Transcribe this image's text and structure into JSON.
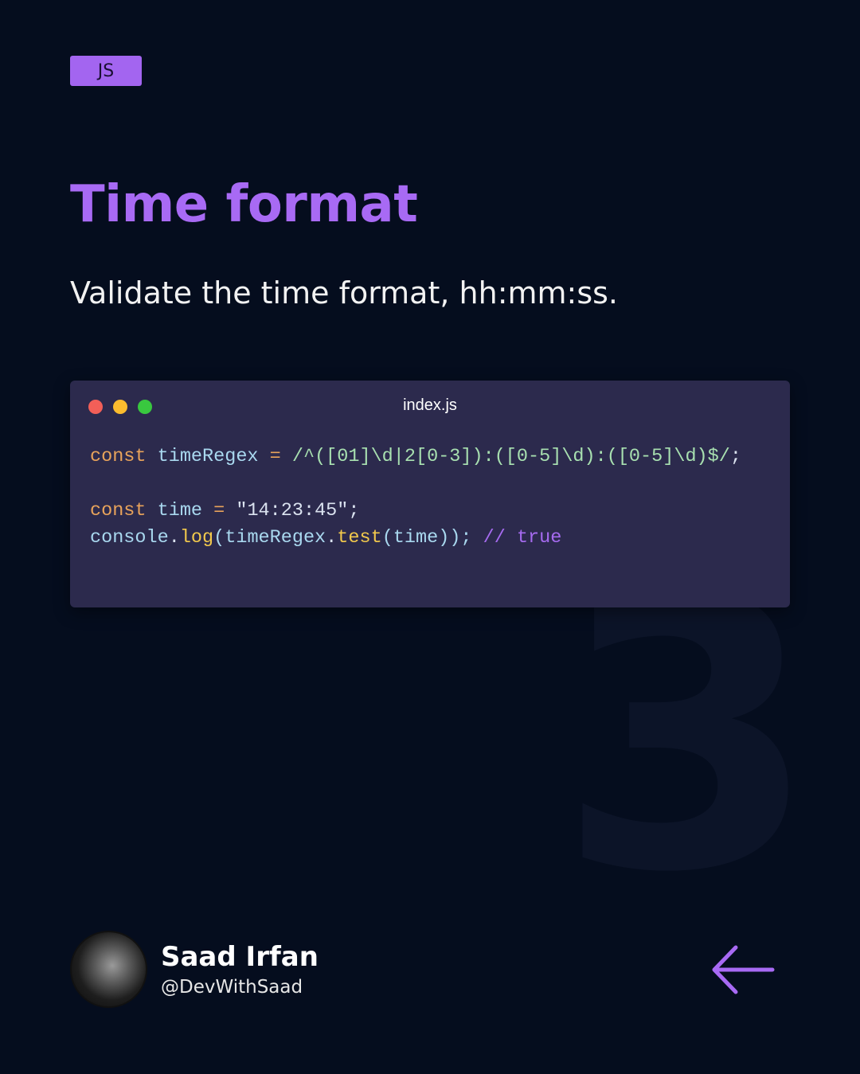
{
  "badge": "JS",
  "title": "Time format",
  "subtitle": "Validate the time format, hh:mm:ss.",
  "slide_number": "3",
  "editor": {
    "filename": "index.js",
    "dots": [
      "#f25f58",
      "#fbbc2e",
      "#39c83f"
    ],
    "line1": {
      "kw": "const",
      "name": " timeRegex ",
      "op": "=",
      "regex": " /^([01]\\d|2[0-3]):([0-5]\\d):([0-5]\\d)$/",
      "end": ";"
    },
    "line2": {
      "kw": "const",
      "name": " time ",
      "op": "=",
      "str": " \"14:23:45\"",
      "end": ";"
    },
    "line3": {
      "obj": "console",
      "dot1": ".",
      "fn1": "log",
      "p1": "(timeRegex",
      "dot2": ".",
      "fn2": "test",
      "p2": "(time));",
      "comment": " // ",
      "result": "true"
    }
  },
  "author": {
    "name": "Saad Irfan",
    "handle": "@DevWithSaad"
  },
  "colors": {
    "accent": "#a86af4",
    "background": "#050d1e",
    "panel": "#2c2a4d"
  }
}
